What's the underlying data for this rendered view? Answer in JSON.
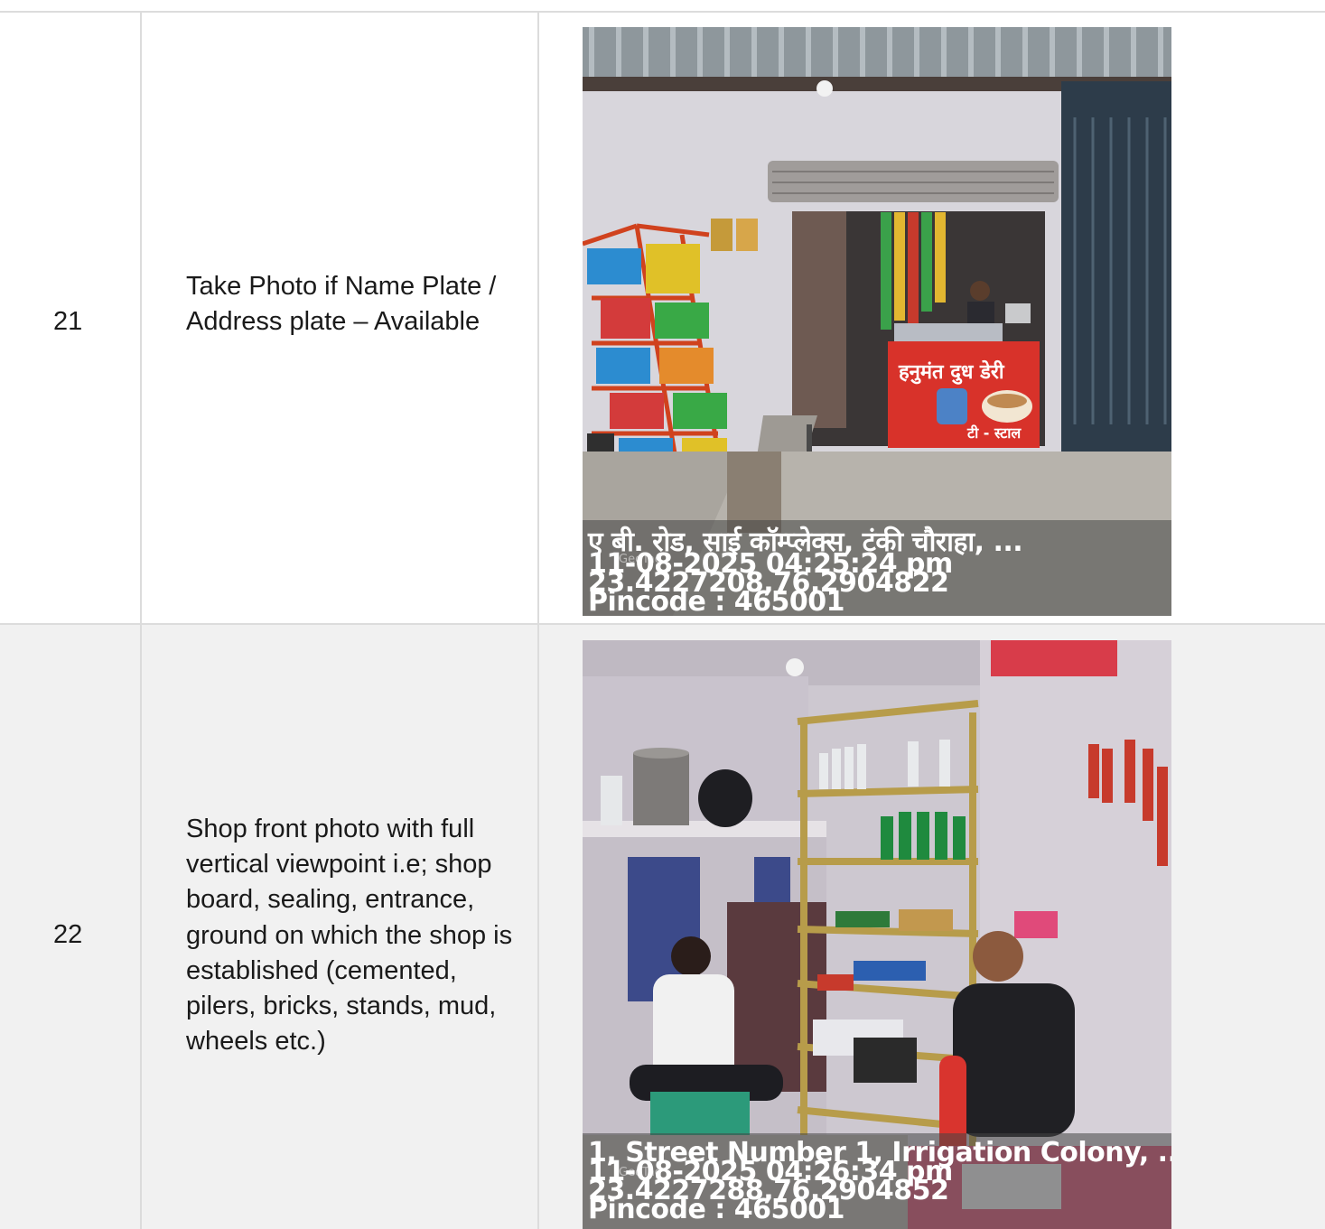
{
  "rows": [
    {
      "number": "21",
      "description": "Take Photo if Name Plate / Address plate – Available",
      "photo": {
        "subject": "roadside tea stall with snack rack",
        "sign_text": "हनुमंत दुध डेरी",
        "sign_sub": "टी - स्टाल",
        "overlay": {
          "address": "ए बी. रोड, साई कॉम्प्लेक्स, टंकी चौराहा, ...",
          "datetime": "11-08-2025 04:25:24 pm",
          "coords": "23.4227208,76.2904822",
          "pincode": "Pincode : 465001",
          "watermark": "GeoTag"
        }
      }
    },
    {
      "number": "22",
      "description": "Shop front photo with full vertical viewpoint i.e; shop board, sealing, entrance, ground on which the shop is established (cemented, pilers, bricks, stands, mud, wheels etc.)",
      "photo": {
        "subject": "shop interior with shelves and two men seated",
        "overlay": {
          "address": "1, Street Number 1, Irrigation Colony, ...",
          "datetime": "11-08-2025 04:26:34 pm",
          "coords": "23.4227288,76.2904852",
          "pincode": "Pincode : 465001",
          "watermark": "GeoTag"
        }
      }
    }
  ],
  "colors": {
    "grid": "#dcdcdc",
    "row_alt_bg": "#f1f1f1",
    "text": "#1a1a1a"
  }
}
